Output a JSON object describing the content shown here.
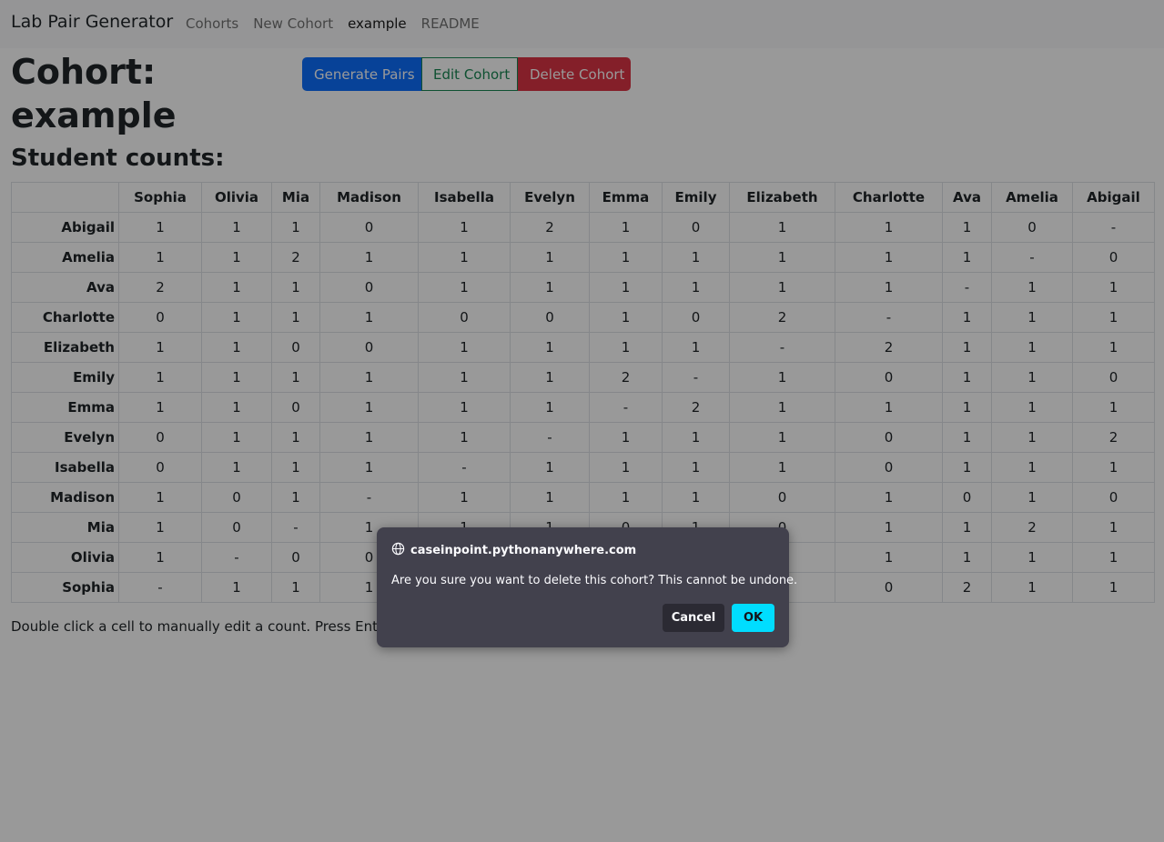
{
  "navbar": {
    "brand": "Lab Pair Generator",
    "links": [
      "Cohorts",
      "New Cohort",
      "example",
      "README"
    ],
    "active_link": "example"
  },
  "page": {
    "title": "Cohort: example",
    "buttons": {
      "generate": "Generate Pairs",
      "edit": "Edit Cohort",
      "delete": "Delete Cohort"
    },
    "subtitle": "Student counts:",
    "note": "Double click a cell to manually edit a count. Press Enter"
  },
  "table": {
    "columns": [
      "Sophia",
      "Olivia",
      "Mia",
      "Madison",
      "Isabella",
      "Evelyn",
      "Emma",
      "Emily",
      "Elizabeth",
      "Charlotte",
      "Ava",
      "Amelia",
      "Abigail"
    ],
    "rows": [
      {
        "name": "Abigail",
        "cells": [
          "1",
          "1",
          "1",
          "0",
          "1",
          "2",
          "1",
          "0",
          "1",
          "1",
          "1",
          "0",
          "-"
        ]
      },
      {
        "name": "Amelia",
        "cells": [
          "1",
          "1",
          "2",
          "1",
          "1",
          "1",
          "1",
          "1",
          "1",
          "1",
          "1",
          "-",
          "0"
        ]
      },
      {
        "name": "Ava",
        "cells": [
          "2",
          "1",
          "1",
          "0",
          "1",
          "1",
          "1",
          "1",
          "1",
          "1",
          "-",
          "1",
          "1"
        ]
      },
      {
        "name": "Charlotte",
        "cells": [
          "0",
          "1",
          "1",
          "1",
          "0",
          "0",
          "1",
          "0",
          "2",
          "-",
          "1",
          "1",
          "1"
        ]
      },
      {
        "name": "Elizabeth",
        "cells": [
          "1",
          "1",
          "0",
          "0",
          "1",
          "1",
          "1",
          "1",
          "-",
          "2",
          "1",
          "1",
          "1"
        ]
      },
      {
        "name": "Emily",
        "cells": [
          "1",
          "1",
          "1",
          "1",
          "1",
          "1",
          "2",
          "-",
          "1",
          "0",
          "1",
          "1",
          "0"
        ]
      },
      {
        "name": "Emma",
        "cells": [
          "1",
          "1",
          "0",
          "1",
          "1",
          "1",
          "-",
          "2",
          "1",
          "1",
          "1",
          "1",
          "1"
        ]
      },
      {
        "name": "Evelyn",
        "cells": [
          "0",
          "1",
          "1",
          "1",
          "1",
          "-",
          "1",
          "1",
          "1",
          "0",
          "1",
          "1",
          "2"
        ]
      },
      {
        "name": "Isabella",
        "cells": [
          "0",
          "1",
          "1",
          "1",
          "-",
          "1",
          "1",
          "1",
          "1",
          "0",
          "1",
          "1",
          "1"
        ]
      },
      {
        "name": "Madison",
        "cells": [
          "1",
          "0",
          "1",
          "-",
          "1",
          "1",
          "1",
          "1",
          "0",
          "1",
          "0",
          "1",
          "0"
        ]
      },
      {
        "name": "Mia",
        "cells": [
          "1",
          "0",
          "-",
          "1",
          "1",
          "1",
          "0",
          "1",
          "0",
          "1",
          "1",
          "2",
          "1"
        ]
      },
      {
        "name": "Olivia",
        "cells": [
          "1",
          "-",
          "0",
          "0",
          "",
          "",
          "",
          "",
          "",
          "1",
          "1",
          "1",
          "1"
        ]
      },
      {
        "name": "Sophia",
        "cells": [
          "-",
          "1",
          "1",
          "1",
          "",
          "",
          "",
          "",
          "",
          "0",
          "2",
          "1",
          "1"
        ]
      }
    ]
  },
  "dialog": {
    "origin": "caseinpoint.pythonanywhere.com",
    "origin_icon": "globe-icon",
    "message": "Are you sure you want to delete this cohort? This cannot be undone.",
    "cancel_label": "Cancel",
    "ok_label": "OK"
  },
  "colors": {
    "primary": "#0d6efd",
    "success": "#198754",
    "danger": "#dc3545",
    "dialog_bg": "#42414d",
    "ok_button": "#00ddff"
  }
}
